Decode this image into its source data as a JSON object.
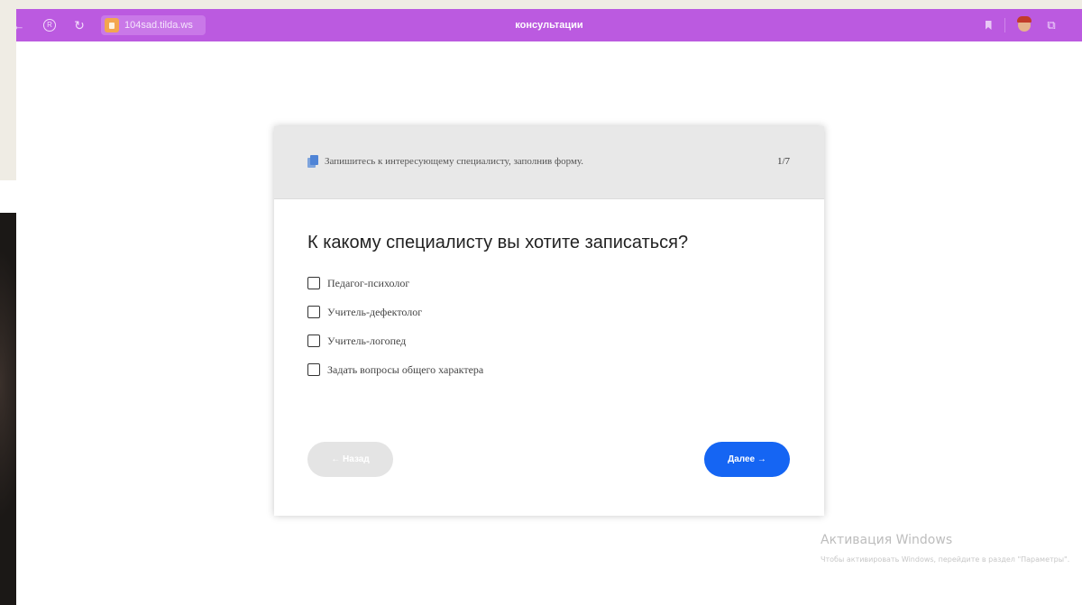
{
  "browser": {
    "url": "104sad.tilda.ws",
    "tab_title": "консультации"
  },
  "form": {
    "header_text": "Запишитесь к интересующему специалисту, заполнив форму.",
    "step": "1/7",
    "question": "К какому специалисту вы хотите записаться?",
    "options": [
      {
        "label": "Педагог-психолог",
        "checked": false
      },
      {
        "label": "Учитель-дефектолог",
        "checked": false
      },
      {
        "label": "Учитель-логопед",
        "checked": false
      },
      {
        "label": "Задать вопросы общего характера",
        "checked": false
      }
    ],
    "back_label": "← Назад",
    "next_label": "Далее →",
    "back_disabled": true
  },
  "watermark": {
    "title": "Активация Windows",
    "subtitle": "Чтобы активировать Windows, перейдите в раздел \"Параметры\"."
  },
  "colors": {
    "toolbar": "#bb5ae0",
    "next_button": "#1565f3",
    "back_button_disabled": "#e4e4e4"
  },
  "icons": [
    "back-arrow-icon",
    "r-circle-icon",
    "reload-icon",
    "site-lock-icon",
    "bookmark-icon",
    "avatar-icon",
    "extensions-icon",
    "document-icon"
  ]
}
